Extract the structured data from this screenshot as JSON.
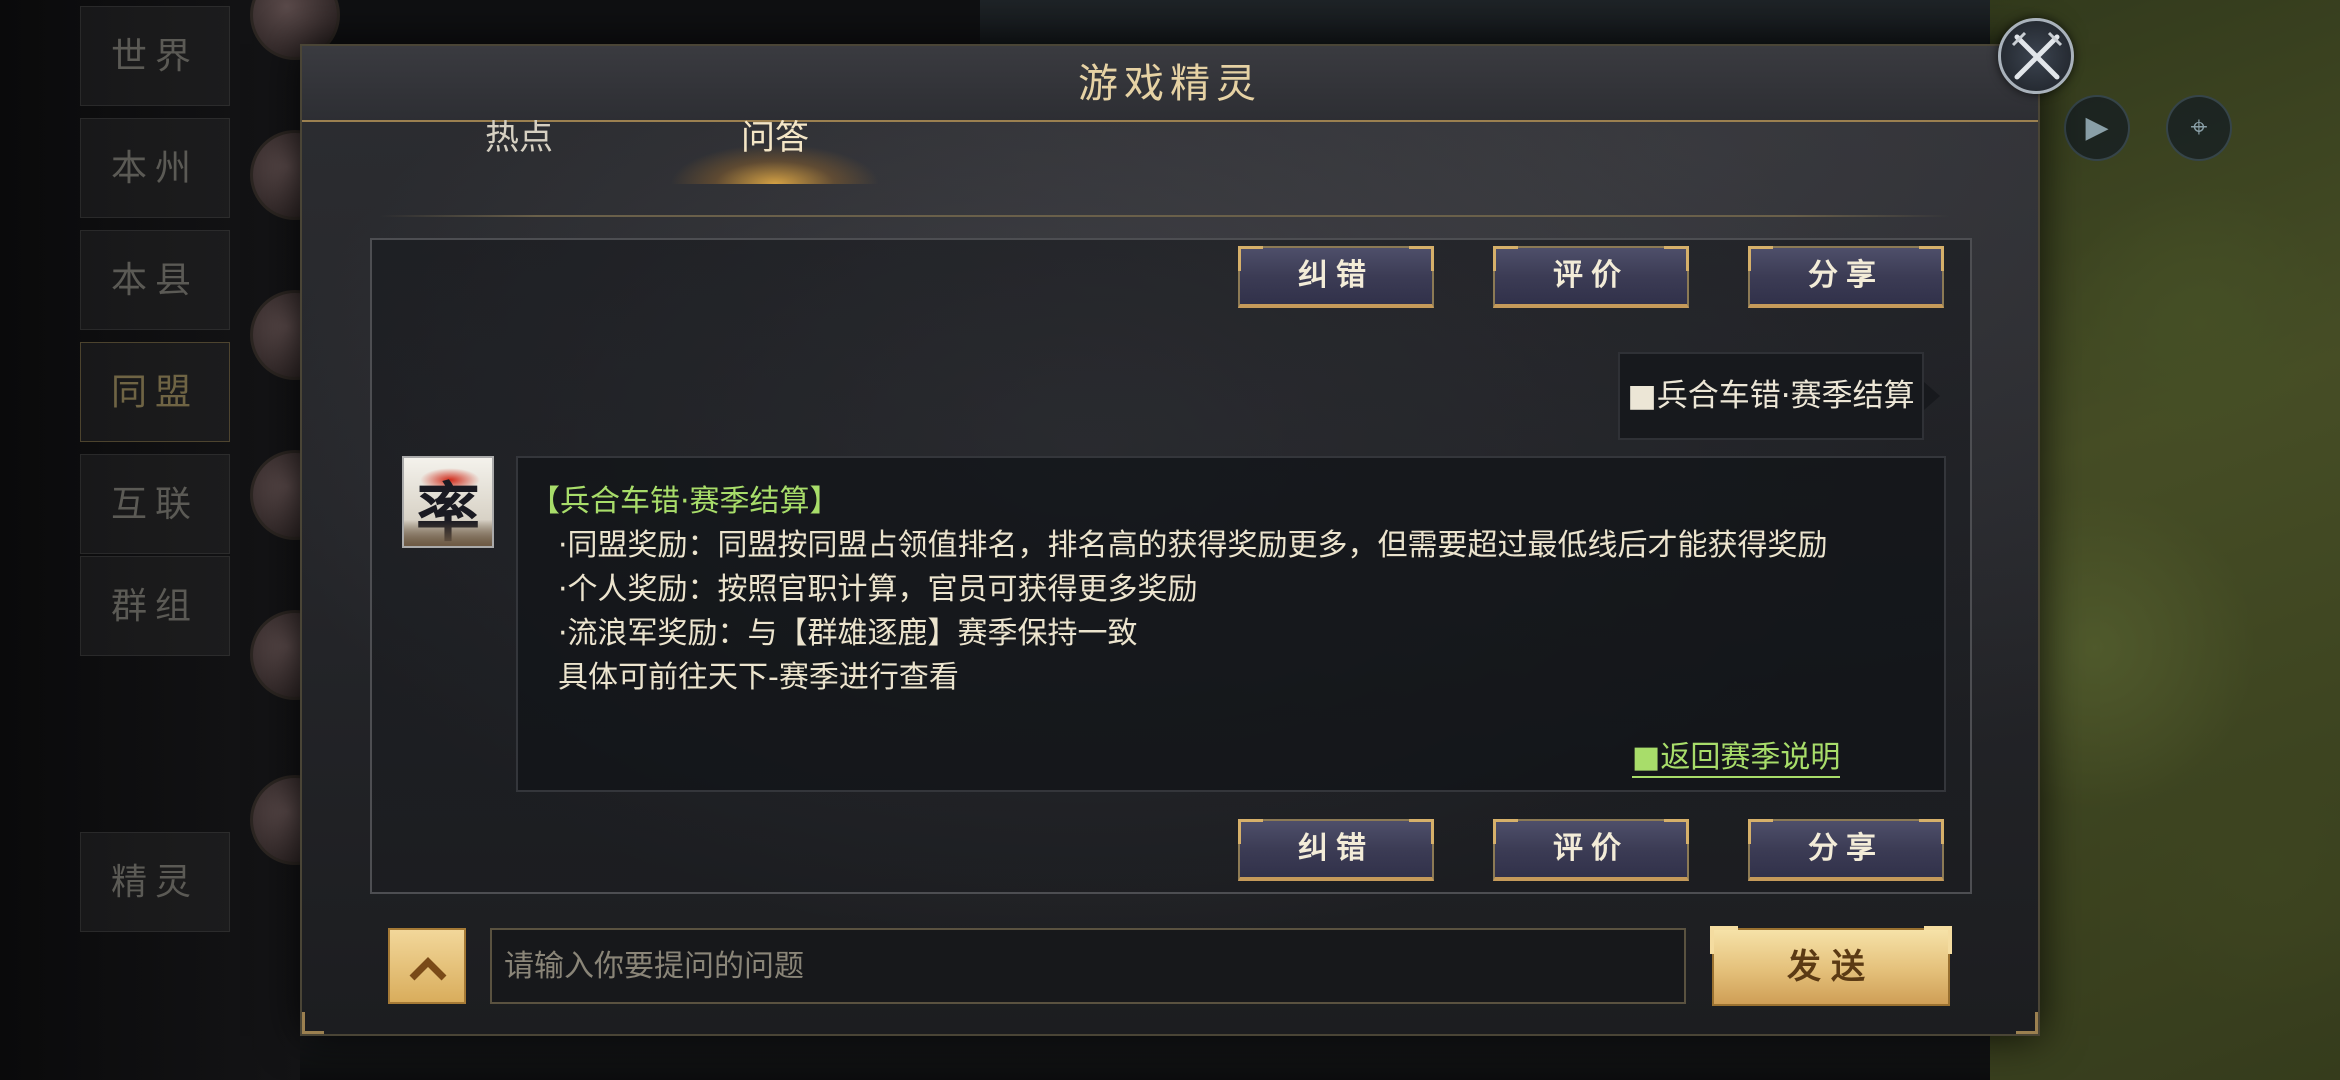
{
  "background": {
    "side_nav": [
      "世界",
      "本州",
      "本县",
      "同盟",
      "互联",
      "群组",
      "精灵"
    ]
  },
  "dialog": {
    "title": "游戏精灵",
    "tabs": [
      {
        "label": "热点",
        "active": false
      },
      {
        "label": "问答",
        "active": true
      }
    ],
    "top_actions": {
      "correct": "纠错",
      "rate": "评价",
      "share": "分享"
    },
    "bottom_actions": {
      "correct": "纠错",
      "rate": "评价",
      "share": "分享"
    },
    "user_message": "■兵合车错·赛季结算",
    "bot_avatar_char": "率",
    "answer": {
      "title": "【兵合车错·赛季结算】",
      "lines": [
        "·同盟奖励：同盟按同盟占领值排名，排名高的获得奖励更多，但需要超过最低线后才能获得奖励",
        "·个人奖励：按照官职计算，官员可获得更多奖励",
        "·流浪军奖励：与【群雄逐鹿】赛季保持一致",
        "具体可前往天下-赛季进行查看"
      ],
      "link": "■返回赛季说明"
    },
    "input": {
      "placeholder": "请输入你要提问的问题",
      "value": ""
    },
    "send_label": "发送"
  },
  "colors": {
    "accent_gold": "#e6d2a4",
    "link_green": "#a8dd6a",
    "button_purple": "#3c3c55"
  }
}
